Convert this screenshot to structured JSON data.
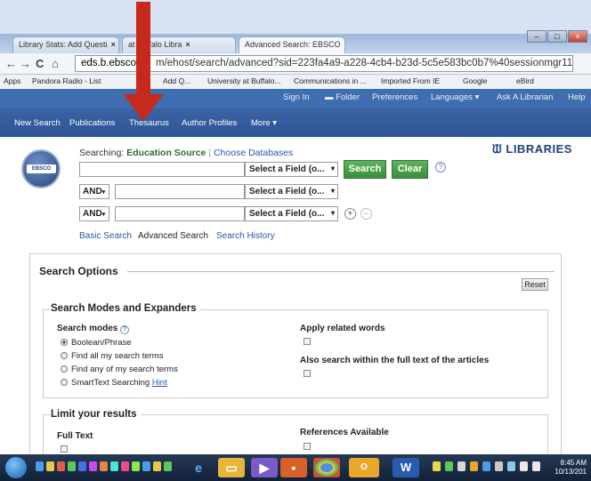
{
  "browser": {
    "tabs": [
      {
        "label": "Library Stats: Add Questi"
      },
      {
        "label": "at Buffalo Libra"
      },
      {
        "label": "Advanced Search: EBSCO"
      }
    ],
    "url_host": "eds.b.ebsco",
    "url_rest": "m/ehost/search/advanced?sid=223fa4a9-a228-4cb4-b23d-5c5e583bc0b7%40sessionmgr115&vid",
    "bookmarks": [
      "Apps",
      "Pandora Radio - List",
      "Add Q...",
      "University at Buffalo...",
      "Communications in ...",
      "Imported From IE",
      "Google",
      "eBird"
    ]
  },
  "ebsco": {
    "top_links": [
      "Sign In",
      "Folder",
      "Preferences",
      "Languages",
      "Ask A Librarian",
      "Help"
    ],
    "nav": [
      "New Search",
      "Publications",
      "Thesaurus",
      "Author Profiles",
      "More"
    ],
    "logo_text": "EBSCO",
    "libraries_logo": "LIBRARIES",
    "searching_label": "Searching:",
    "database": "Education Source",
    "choose_db": "Choose Databases",
    "field_placeholder": "Select a Field (o...",
    "search_button": "Search",
    "clear_button": "Clear",
    "bool_and": "AND",
    "sub_links": [
      "Basic Search",
      "Advanced Search",
      "Search History"
    ]
  },
  "options": {
    "title": "Search Options",
    "reset": "Reset",
    "modes_section": "Search Modes and Expanders",
    "search_modes_label": "Search modes",
    "modes": [
      "Boolean/Phrase",
      "Find all my search terms",
      "Find any of my search terms",
      "SmartText Searching"
    ],
    "hint": "Hint",
    "selected_mode": "Boolean/Phrase",
    "apply_related": "Apply related words",
    "full_text_search": "Also search within the full text of the articles",
    "limit_section": "Limit your results",
    "full_text": "Full Text",
    "references": "References Available"
  },
  "taskbar": {
    "time": "8:45 AM",
    "date": "10/13/201"
  }
}
